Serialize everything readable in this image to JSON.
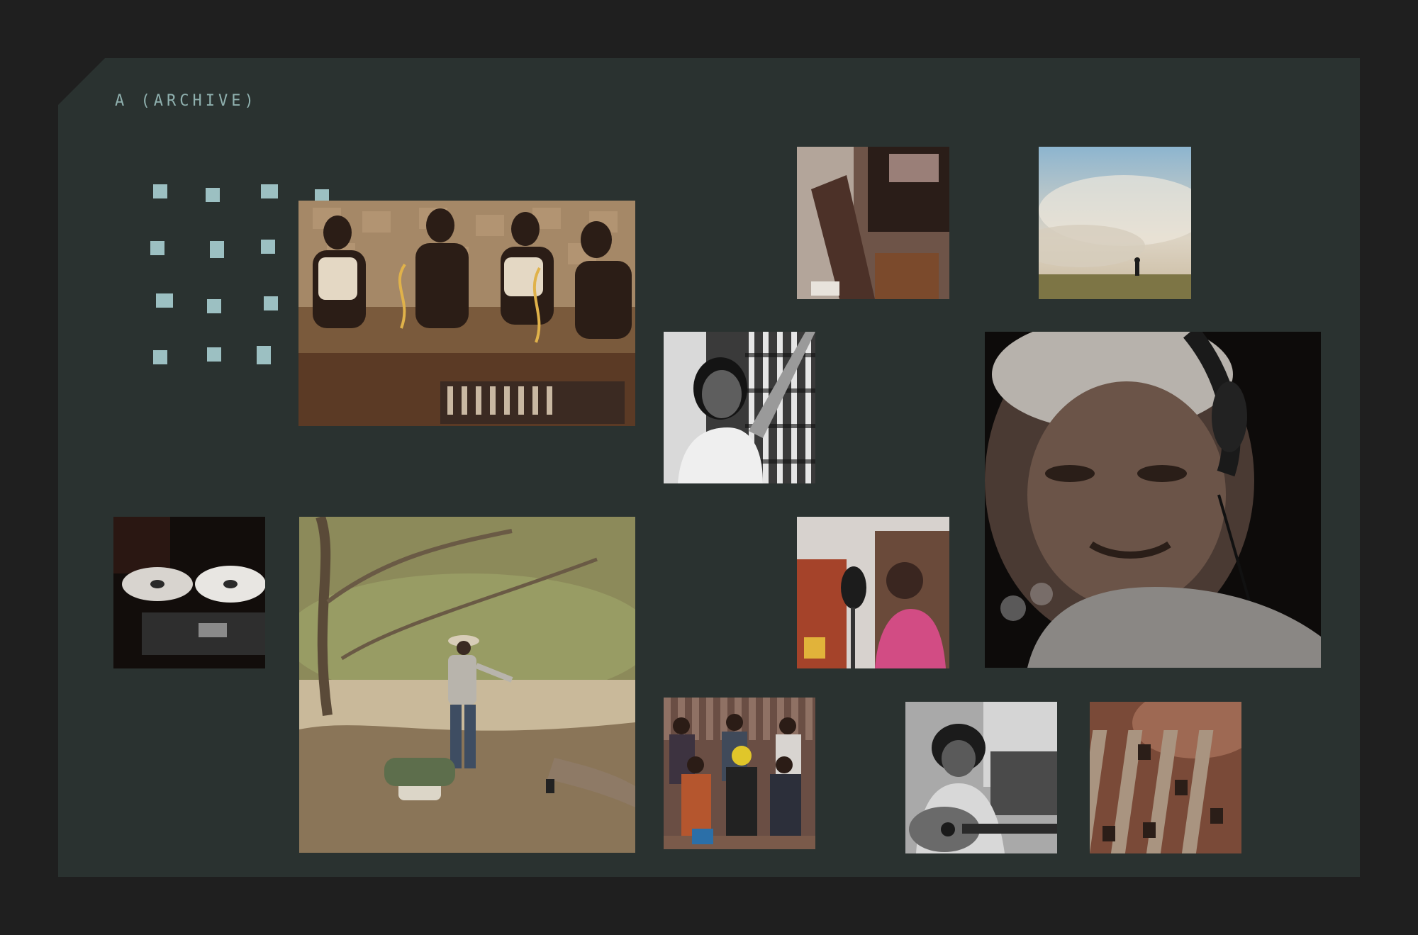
{
  "archive": {
    "label": "A (ARCHIVE)"
  },
  "colors": {
    "page_background": "#1f1f1f",
    "panel_background": "#2a3230",
    "label_color": "#8fb0ae",
    "dot_color": "#a8cfd3"
  },
  "tiles": [
    {
      "name": "photo-studio-band",
      "description": "band"
    },
    {
      "name": "photo-hands-guitar"
    },
    {
      "name": "photo-smoke-field"
    },
    {
      "name": "photo-woman-tape-archive"
    },
    {
      "name": "photo-elder-headphones"
    },
    {
      "name": "photo-reel-to-reel"
    },
    {
      "name": "photo-man-dancing-creek"
    },
    {
      "name": "photo-singer-microphone"
    },
    {
      "name": "photo-group-seated"
    },
    {
      "name": "photo-man-guitar"
    },
    {
      "name": "photo-mixing-faders"
    }
  ]
}
